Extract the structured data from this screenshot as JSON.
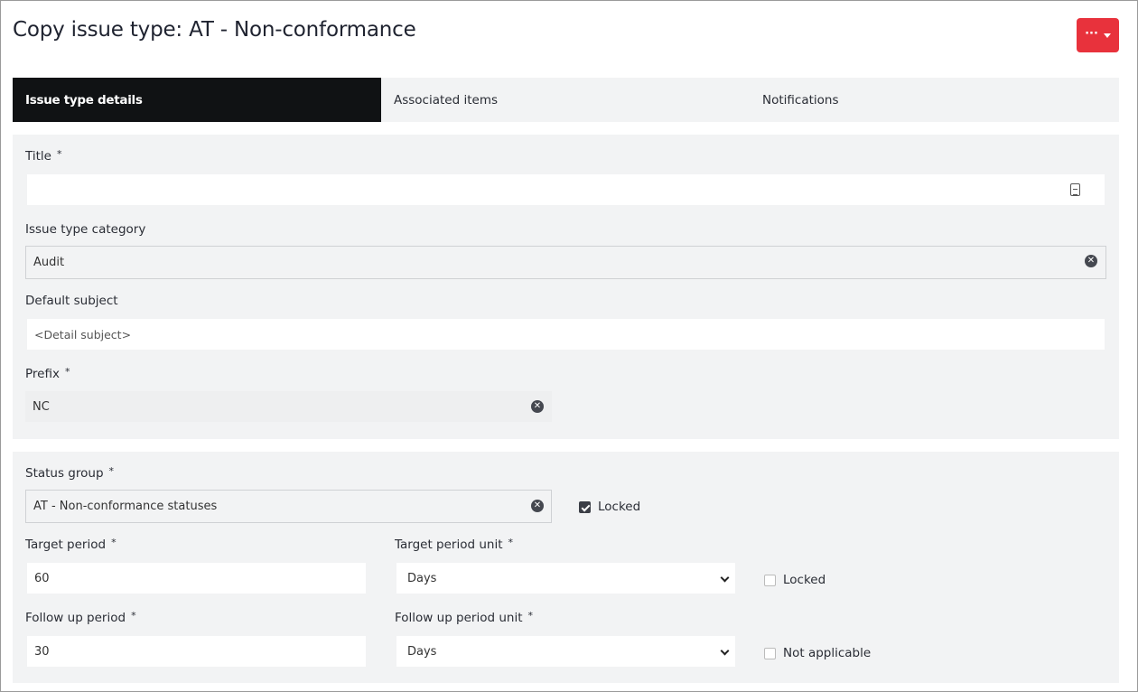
{
  "page": {
    "title": "Copy issue type: AT - Non-conformance",
    "actions_dots": "···"
  },
  "tabs": [
    {
      "label": "Issue type details",
      "active": true
    },
    {
      "label": "Associated items",
      "active": false
    },
    {
      "label": "Notifications",
      "active": false
    }
  ],
  "form": {
    "required_mark": "*",
    "title": {
      "label": "Title",
      "value": "",
      "required": true
    },
    "issue_type_category": {
      "label": "Issue type category",
      "value": "Audit"
    },
    "default_subject": {
      "label": "Default subject",
      "value": "<Detail subject>"
    },
    "prefix": {
      "label": "Prefix",
      "value": "NC",
      "required": true
    },
    "status_group": {
      "label": "Status group",
      "value": "AT - Non-conformance statuses",
      "required": true,
      "locked_label": "Locked",
      "locked": true
    },
    "target_period": {
      "label": "Target period",
      "value": "60",
      "required": true
    },
    "target_period_unit": {
      "label": "Target period unit",
      "value": "Days",
      "required": true,
      "locked_label": "Locked",
      "locked": false
    },
    "follow_up_period": {
      "label": "Follow up period",
      "value": "30",
      "required": true
    },
    "follow_up_period_unit": {
      "label": "Follow up period unit",
      "value": "Days",
      "required": true,
      "not_applicable_label": "Not applicable",
      "not_applicable": false
    }
  },
  "icons": {
    "clear": "x-circle-icon",
    "document": "document-icon",
    "dropdown": "chevron-down-icon"
  },
  "colors": {
    "accent": "#e8323c",
    "active_tab": "#101214",
    "panel_bg": "#f2f3f4"
  }
}
